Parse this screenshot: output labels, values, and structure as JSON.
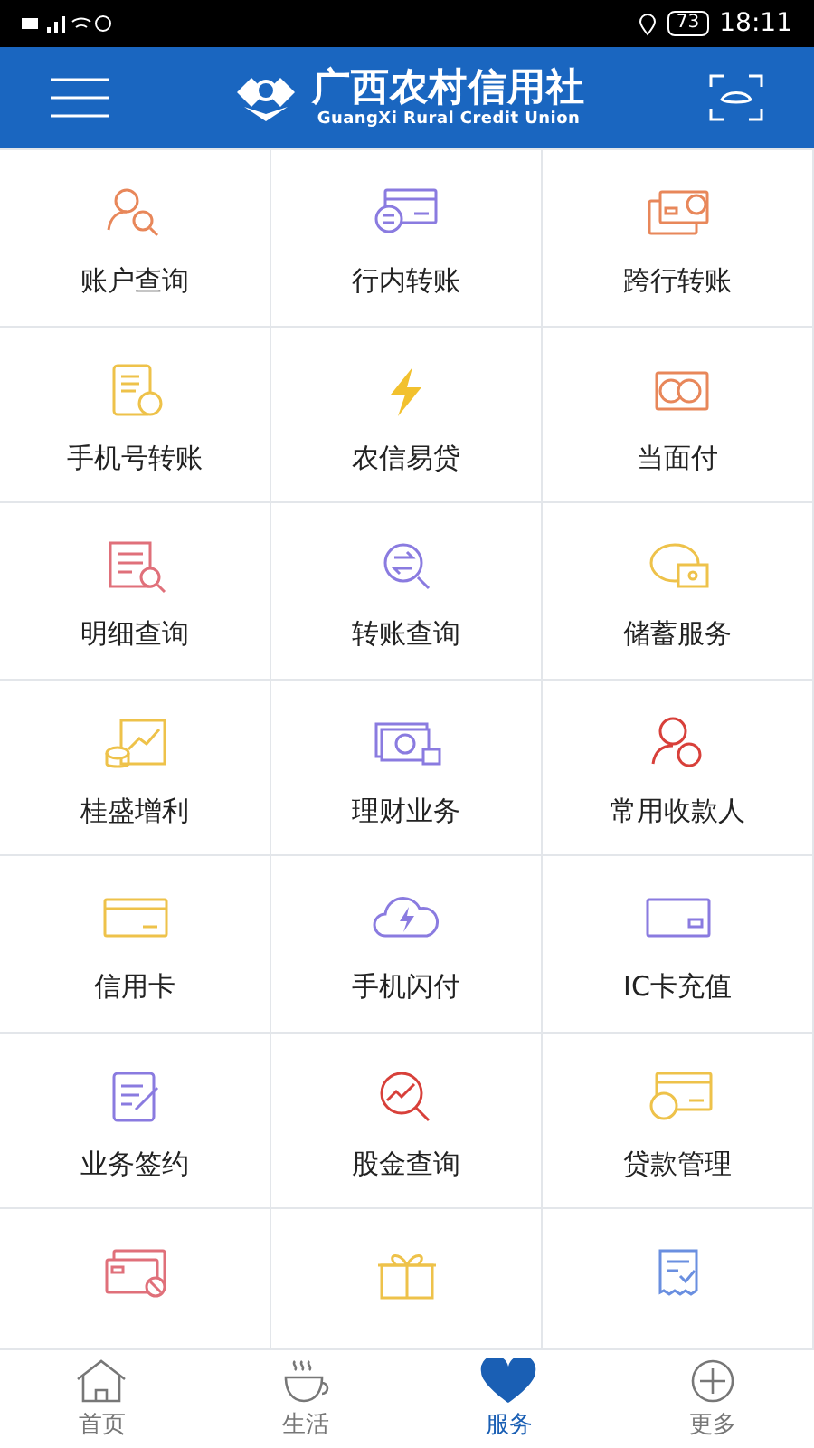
{
  "status_bar": {
    "battery": "73",
    "time": "18:11"
  },
  "header": {
    "title": "广西农村信用社",
    "subtitle": "GuangXi Rural Credit Union"
  },
  "services": [
    {
      "label": "账户查询"
    },
    {
      "label": "行内转账"
    },
    {
      "label": "跨行转账"
    },
    {
      "label": "手机号转账"
    },
    {
      "label": "农信易贷"
    },
    {
      "label": "当面付"
    },
    {
      "label": "明细查询"
    },
    {
      "label": "转账查询"
    },
    {
      "label": "储蓄服务"
    },
    {
      "label": "桂盛增利"
    },
    {
      "label": "理财业务"
    },
    {
      "label": "常用收款人"
    },
    {
      "label": "信用卡"
    },
    {
      "label": "手机闪付"
    },
    {
      "label": "IC卡充值"
    },
    {
      "label": "业务签约"
    },
    {
      "label": "股金查询"
    },
    {
      "label": "贷款管理"
    },
    {
      "kind": "cut_off"
    },
    {
      "kind": "cut_off"
    },
    {
      "kind": "cut_off"
    }
  ],
  "bottom_nav": [
    {
      "label": "首页",
      "selected": false
    },
    {
      "label": "生活",
      "selected": false
    },
    {
      "label": "服务",
      "selected": true
    },
    {
      "label": "更多",
      "selected": false
    }
  ]
}
